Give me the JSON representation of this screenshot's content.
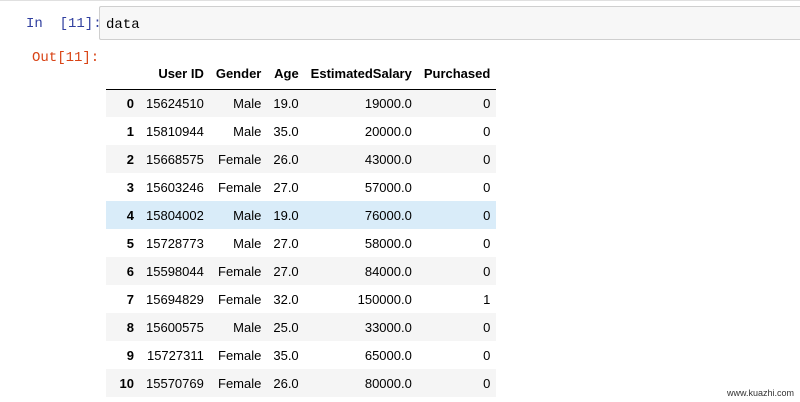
{
  "in_cell": {
    "prompt": "In  [11]:",
    "code": "data"
  },
  "out_cell": {
    "prompt": "Out[11]:"
  },
  "table": {
    "columns": [
      "",
      "User ID",
      "Gender",
      "Age",
      "EstimatedSalary",
      "Purchased"
    ],
    "rows": [
      {
        "index": "0",
        "user_id": "15624510",
        "gender": "Male",
        "age": "19.0",
        "salary": "19000.0",
        "purchased": "0"
      },
      {
        "index": "1",
        "user_id": "15810944",
        "gender": "Male",
        "age": "35.0",
        "salary": "20000.0",
        "purchased": "0"
      },
      {
        "index": "2",
        "user_id": "15668575",
        "gender": "Female",
        "age": "26.0",
        "salary": "43000.0",
        "purchased": "0"
      },
      {
        "index": "3",
        "user_id": "15603246",
        "gender": "Female",
        "age": "27.0",
        "salary": "57000.0",
        "purchased": "0"
      },
      {
        "index": "4",
        "user_id": "15804002",
        "gender": "Male",
        "age": "19.0",
        "salary": "76000.0",
        "purchased": "0"
      },
      {
        "index": "5",
        "user_id": "15728773",
        "gender": "Male",
        "age": "27.0",
        "salary": "58000.0",
        "purchased": "0"
      },
      {
        "index": "6",
        "user_id": "15598044",
        "gender": "Female",
        "age": "27.0",
        "salary": "84000.0",
        "purchased": "0"
      },
      {
        "index": "7",
        "user_id": "15694829",
        "gender": "Female",
        "age": "32.0",
        "salary": "150000.0",
        "purchased": "1"
      },
      {
        "index": "8",
        "user_id": "15600575",
        "gender": "Male",
        "age": "25.0",
        "salary": "33000.0",
        "purchased": "0"
      },
      {
        "index": "9",
        "user_id": "15727311",
        "gender": "Female",
        "age": "35.0",
        "salary": "65000.0",
        "purchased": "0"
      },
      {
        "index": "10",
        "user_id": "15570769",
        "gender": "Female",
        "age": "26.0",
        "salary": "80000.0",
        "purchased": "0"
      }
    ],
    "highlighted_row": "4"
  },
  "watermark": "www.kuazhi.com",
  "colors": {
    "in_prompt": "#303f9f",
    "out_prompt": "#d84315",
    "highlight_row": "#d9ecf9",
    "stripe_row": "#f5f5f5"
  }
}
